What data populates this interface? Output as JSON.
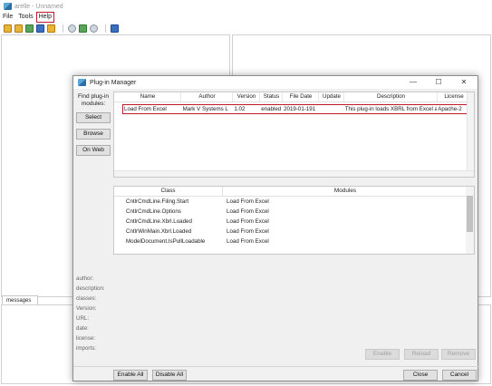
{
  "app": {
    "title": "arelle - Unnamed",
    "menu": [
      "File",
      "Tools",
      "Help"
    ]
  },
  "messages_tab": "messages",
  "dialog": {
    "title": "Plug-in Manager",
    "find_label": "Find plug-in modules:",
    "side_buttons": [
      "Select",
      "Browse",
      "On Web"
    ],
    "columns": [
      "Name",
      "Author",
      "Version",
      "Status",
      "File Date",
      "Update",
      "Description",
      "License"
    ],
    "row": {
      "name": "Load From Excel",
      "author": "Mark V Systems L",
      "version": "1.02",
      "status": "enabled",
      "file_date": "2019-01-191",
      "update": "",
      "description": "This plug-in loads XBRL from Excel a",
      "license": "Apache-2"
    },
    "class_columns": [
      "Class",
      "Modules"
    ],
    "classes": [
      {
        "class": "CntlrCmdLine.Filing.Start",
        "module": "Load From Excel"
      },
      {
        "class": "CntlrCmdLine.Options",
        "module": "Load From Excel"
      },
      {
        "class": "CntlrCmdLine.Xbrl.Loaded",
        "module": "Load From Excel"
      },
      {
        "class": "CntlrWinMain.Xbrl.Loaded",
        "module": "Load From Excel"
      },
      {
        "class": "ModelDocument.IsPullLoadable",
        "module": "Load From Excel"
      }
    ],
    "details": [
      "author:",
      "description:",
      "classes:",
      "Version:",
      "URL:",
      "date:",
      "license:",
      "imports:"
    ],
    "action_buttons": [
      "Enable",
      "Reload",
      "Remove"
    ],
    "bottom_buttons": {
      "enable_all": "Enable All",
      "disable_all": "Disable All",
      "close": "Close",
      "cancel": "Cancel"
    },
    "window_controls": {
      "min": "—",
      "max": "☐",
      "close": "✕"
    }
  }
}
